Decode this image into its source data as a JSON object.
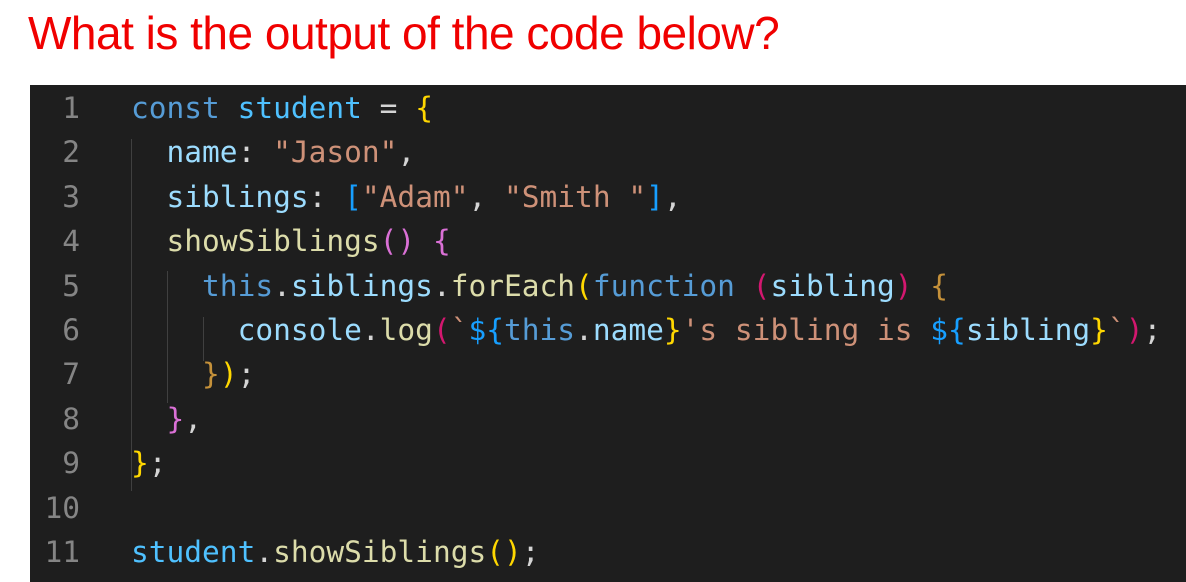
{
  "question": "What is the output of the code below?",
  "colors": {
    "background": "#1e1e1e",
    "title": "#f00000",
    "line_number": "#858585"
  },
  "code_lines": [
    {
      "number": "1",
      "tokens": [
        [
          "const ",
          "#569cd6"
        ],
        [
          "student",
          "#4fc1ff"
        ],
        [
          " = ",
          "#d4d4d4"
        ],
        [
          "{",
          "#ffd700"
        ]
      ]
    },
    {
      "number": "2",
      "tokens": [
        [
          "  name",
          "#9cdcfe"
        ],
        [
          ": ",
          "#d4d4d4"
        ],
        [
          "\"Jason\"",
          "#ce9178"
        ],
        [
          ",",
          "#d4d4d4"
        ]
      ]
    },
    {
      "number": "3",
      "tokens": [
        [
          "  siblings",
          "#9cdcfe"
        ],
        [
          ": ",
          "#d4d4d4"
        ],
        [
          "[",
          "#179fff"
        ],
        [
          "\"Adam\"",
          "#ce9178"
        ],
        [
          ", ",
          "#d4d4d4"
        ],
        [
          "\"Smith \"",
          "#ce9178"
        ],
        [
          "]",
          "#179fff"
        ],
        [
          ",",
          "#d4d4d4"
        ]
      ]
    },
    {
      "number": "4",
      "tokens": [
        [
          "  showSiblings",
          "#dcdcaa"
        ],
        [
          "()",
          "#da70d6"
        ],
        [
          " ",
          "#d4d4d4"
        ],
        [
          "{",
          "#da70d6"
        ]
      ]
    },
    {
      "number": "5",
      "tokens": [
        [
          "    this",
          "#569cd6"
        ],
        [
          ".",
          "#d4d4d4"
        ],
        [
          "siblings",
          "#9cdcfe"
        ],
        [
          ".",
          "#d4d4d4"
        ],
        [
          "forEach",
          "#dcdcaa"
        ],
        [
          "(",
          "#ffd700"
        ],
        [
          "function ",
          "#569cd6"
        ],
        [
          "(",
          "#d3176f"
        ],
        [
          "sibling",
          "#9cdcfe"
        ],
        [
          ")",
          "#d3176f"
        ],
        [
          " ",
          "#d4d4d4"
        ],
        [
          "{",
          "#c5913a"
        ]
      ]
    },
    {
      "number": "6",
      "tokens": [
        [
          "      console",
          "#9cdcfe"
        ],
        [
          ".",
          "#d4d4d4"
        ],
        [
          "log",
          "#dcdcaa"
        ],
        [
          "(",
          "#d3176f"
        ],
        [
          "`",
          "#ce9178"
        ],
        [
          "${",
          "#179fff"
        ],
        [
          "this",
          "#569cd6"
        ],
        [
          ".",
          "#d4d4d4"
        ],
        [
          "name",
          "#9cdcfe"
        ],
        [
          "}",
          "#ffd700"
        ],
        [
          "'s sibling is ",
          "#ce9178"
        ],
        [
          "${",
          "#179fff"
        ],
        [
          "sibling",
          "#9cdcfe"
        ],
        [
          "}",
          "#ffd700"
        ],
        [
          "`",
          "#ce9178"
        ],
        [
          ")",
          "#d3176f"
        ],
        [
          ";",
          "#d4d4d4"
        ]
      ]
    },
    {
      "number": "7",
      "tokens": [
        [
          "    }",
          "#c5913a"
        ],
        [
          ")",
          "#ffd700"
        ],
        [
          ";",
          "#d4d4d4"
        ]
      ]
    },
    {
      "number": "8",
      "tokens": [
        [
          "  }",
          "#da70d6"
        ],
        [
          ",",
          "#d4d4d4"
        ]
      ]
    },
    {
      "number": "9",
      "tokens": [
        [
          "}",
          "#ffd700"
        ],
        [
          ";",
          "#d4d4d4"
        ]
      ]
    },
    {
      "number": "10",
      "tokens": []
    },
    {
      "number": "11",
      "tokens": [
        [
          "student",
          "#4fc1ff"
        ],
        [
          ".",
          "#d4d4d4"
        ],
        [
          "showSiblings",
          "#dcdcaa"
        ],
        [
          "()",
          "#ffd700"
        ],
        [
          ";",
          "#d4d4d4"
        ]
      ]
    }
  ]
}
